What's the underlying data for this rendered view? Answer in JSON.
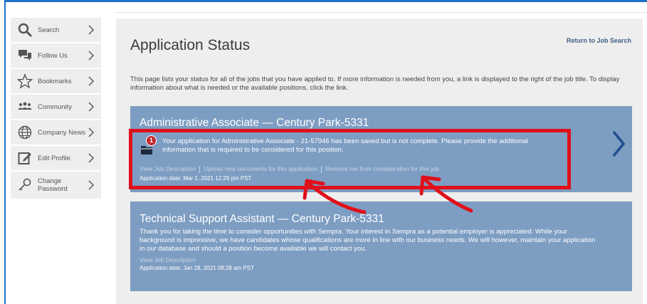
{
  "sidebar": {
    "items": [
      {
        "label": "Search",
        "icon": "search-icon"
      },
      {
        "label": "Follow Us",
        "icon": "chat-icon"
      },
      {
        "label": "Bookmarks",
        "icon": "star-icon"
      },
      {
        "label": "Community",
        "icon": "people-icon"
      },
      {
        "label": "Company News",
        "icon": "globe-icon"
      },
      {
        "label": "Edit Profile",
        "icon": "edit-icon"
      },
      {
        "label": "Change Password",
        "icon": "key-icon"
      }
    ]
  },
  "main": {
    "title": "Application Status",
    "return_link": "Return to Job Search",
    "description": "This page lists your status for all of the jobs that you have applied to. If more information is needed from you, a link is displayed to the right of the job title. To display information about what is needed or the available positions, click the link."
  },
  "applications": [
    {
      "title": "Administrative Associate — Century Park-5331",
      "badge_count": "1",
      "notice": "Your application for Administrative Associate - 21-57946 has been saved but is not complete. Please provide the additional information that is required to be considered for this position.",
      "links": [
        "View Job Description",
        "Upload new documents for this application",
        "Remove me from consideration for this job"
      ],
      "date": "Application date: Mar 1, 2021 12:29 pm PST"
    },
    {
      "title": "Technical Support Assistant — Century Park-5331",
      "body": "Thank you for taking the time to consider opportunities with Sempra. Your interest in Sempra as a potential employer is appreciated. While your background is impressive, we have candidates whose qualifications are more in line with our business needs. We will however, maintain your application in our database and should a position become available we will contact you.",
      "link": "View Job Description",
      "date": "Application date: Jan 28, 2021 08:28 am PST"
    }
  ],
  "colors": {
    "card": "#7d9dc2",
    "highlight": "#e0101a",
    "chevron": "#1f4f8f"
  }
}
